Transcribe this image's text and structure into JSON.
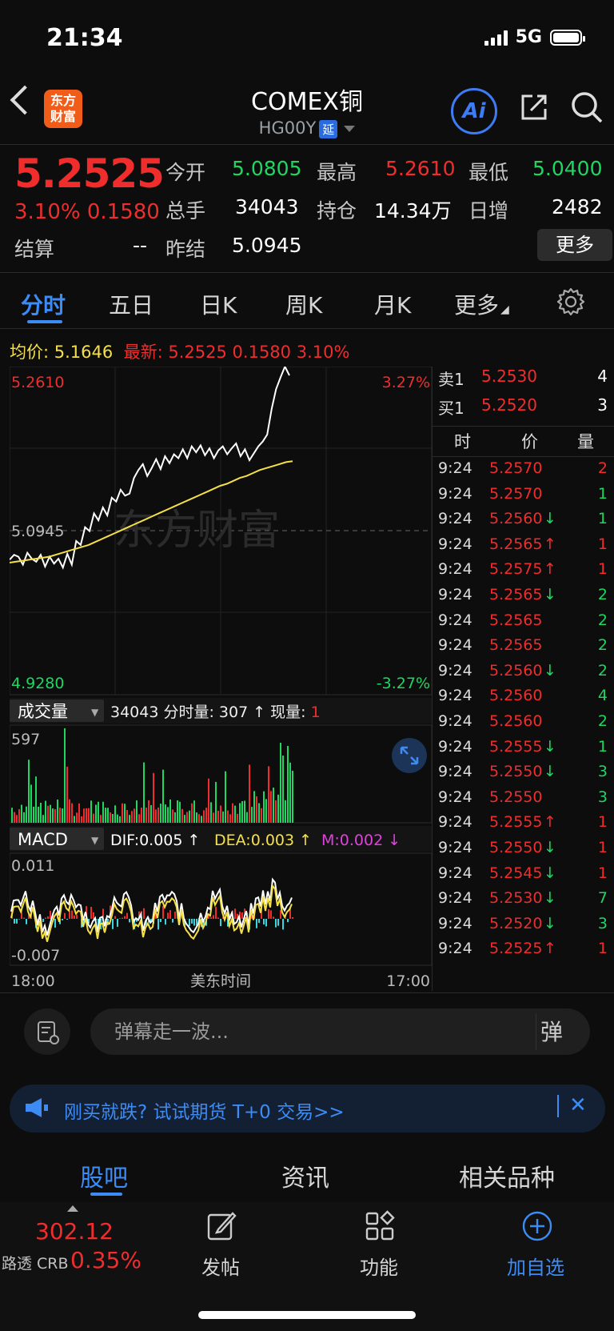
{
  "status_bar": {
    "time": "21:34",
    "network": "5G"
  },
  "header": {
    "logo_text_line1": "东方",
    "logo_text_line2": "财富",
    "title": "COMEX铜",
    "code": "HG00Y",
    "delay_tag": "延",
    "ai_label": "Ai"
  },
  "quote": {
    "price": "5.2525",
    "change_pct": "3.10%",
    "change": "0.1580",
    "fields": {
      "open_label": "今开",
      "open": "5.0805",
      "high_label": "最高",
      "high": "5.2610",
      "low_label": "最低",
      "low": "5.0400",
      "volume_label": "总手",
      "volume": "34043",
      "oi_label": "持仓",
      "oi": "14.34万",
      "daily_inc_label": "日增",
      "daily_inc": "2482",
      "settle_label": "结算",
      "settle": "--",
      "prev_settle_label": "昨结",
      "prev_settle": "5.0945"
    },
    "more_button": "更多"
  },
  "chart_tabs": [
    "分时",
    "五日",
    "日K",
    "周K",
    "月K",
    "更多"
  ],
  "info_line": {
    "avg_label": "均价:",
    "avg": "5.1646",
    "last_label": "最新:",
    "last": "5.2525",
    "change": "0.1580",
    "pct": "3.10%"
  },
  "chart_labels": {
    "top_price": "5.2610",
    "top_pct": "3.27%",
    "mid_price": "5.0945",
    "bottom_price": "4.9280",
    "bottom_pct": "-3.27%",
    "watermark": "东方财富",
    "vol_indicator": "成交量",
    "vol_text": "34043 分时量: 307 ↑ 现量: ",
    "vol_current": "1",
    "vol_max": "597",
    "macd_indicator": "MACD",
    "dif": "DIF:0.005 ↑",
    "dea": "DEA:0.003 ↑",
    "m": "M:0.002 ↓",
    "macd_top": "0.011",
    "macd_bottom": "-0.007",
    "time_start": "18:00",
    "time_mid": "美东时间",
    "time_end": "17:00"
  },
  "order_book": {
    "ask_label": "卖1",
    "ask_price": "5.2530",
    "ask_vol": "4",
    "bid_label": "买1",
    "bid_price": "5.2520",
    "bid_vol": "3"
  },
  "trades_header": {
    "time": "时",
    "price": "价",
    "vol": "量"
  },
  "trades": [
    {
      "time": "9:24",
      "price": "5.2570",
      "arrow": "",
      "vol": "2",
      "dir": "up"
    },
    {
      "time": "9:24",
      "price": "5.2570",
      "arrow": "",
      "vol": "1",
      "dir": "down"
    },
    {
      "time": "9:24",
      "price": "5.2560",
      "arrow": "↓",
      "vol": "1",
      "dir": "down"
    },
    {
      "time": "9:24",
      "price": "5.2565",
      "arrow": "↑",
      "vol": "1",
      "dir": "up"
    },
    {
      "time": "9:24",
      "price": "5.2575",
      "arrow": "↑",
      "vol": "1",
      "dir": "up"
    },
    {
      "time": "9:24",
      "price": "5.2565",
      "arrow": "↓",
      "vol": "2",
      "dir": "down"
    },
    {
      "time": "9:24",
      "price": "5.2565",
      "arrow": "",
      "vol": "2",
      "dir": "down"
    },
    {
      "time": "9:24",
      "price": "5.2565",
      "arrow": "",
      "vol": "2",
      "dir": "down"
    },
    {
      "time": "9:24",
      "price": "5.2560",
      "arrow": "↓",
      "vol": "2",
      "dir": "down"
    },
    {
      "time": "9:24",
      "price": "5.2560",
      "arrow": "",
      "vol": "4",
      "dir": "down"
    },
    {
      "time": "9:24",
      "price": "5.2560",
      "arrow": "",
      "vol": "2",
      "dir": "down"
    },
    {
      "time": "9:24",
      "price": "5.2555",
      "arrow": "↓",
      "vol": "1",
      "dir": "down"
    },
    {
      "time": "9:24",
      "price": "5.2550",
      "arrow": "↓",
      "vol": "3",
      "dir": "down"
    },
    {
      "time": "9:24",
      "price": "5.2550",
      "arrow": "",
      "vol": "3",
      "dir": "down"
    },
    {
      "time": "9:24",
      "price": "5.2555",
      "arrow": "↑",
      "vol": "1",
      "dir": "up"
    },
    {
      "time": "9:24",
      "price": "5.2550",
      "arrow": "↓",
      "vol": "1",
      "dir": "up"
    },
    {
      "time": "9:24",
      "price": "5.2545",
      "arrow": "↓",
      "vol": "1",
      "dir": "up"
    },
    {
      "time": "9:24",
      "price": "5.2530",
      "arrow": "↓",
      "vol": "7",
      "dir": "down"
    },
    {
      "time": "9:24",
      "price": "5.2520",
      "arrow": "↓",
      "vol": "3",
      "dir": "down"
    },
    {
      "time": "9:24",
      "price": "5.2525",
      "arrow": "↑",
      "vol": "1",
      "dir": "up"
    }
  ],
  "danmaku": {
    "placeholder": "弹幕走一波...",
    "send_label": "弹"
  },
  "promo": {
    "text": "刚买就跌? 试试期货 T+0 交易>>"
  },
  "community_tabs": [
    "股吧",
    "资讯",
    "相关品种"
  ],
  "bottom_nav": {
    "crb_value": "302.12",
    "crb_name": "路透 CRB",
    "crb_pct": "0.35%",
    "post_label": "发帖",
    "func_label": "功能",
    "add_label": "加自选"
  },
  "colors": {
    "up": "#f02d2d",
    "down": "#1ed760",
    "accent": "#3d8bf5",
    "avg_line": "#f5e047"
  },
  "chart_data": {
    "type": "line",
    "x_range": [
      "18:00",
      "17:00"
    ],
    "ylim": [
      4.928,
      5.261
    ],
    "reference": 5.0945,
    "series": [
      {
        "values": [
          5.065,
          5.07,
          5.068,
          5.06,
          5.072,
          5.066,
          5.063,
          5.07,
          5.058,
          5.068,
          5.061,
          5.066,
          5.057,
          5.071,
          5.06,
          5.084,
          5.08,
          5.098,
          5.094,
          5.112,
          5.105,
          5.118,
          5.11,
          5.128,
          5.124,
          5.136,
          5.13,
          5.132,
          5.148,
          5.156,
          5.162,
          5.15,
          5.158,
          5.167,
          5.157,
          5.17,
          5.163,
          5.172,
          5.168,
          5.177,
          5.168,
          5.18,
          5.174,
          5.181,
          5.171,
          5.178,
          5.168,
          5.176,
          5.18,
          5.172,
          5.178,
          5.183,
          5.17,
          5.177,
          5.166,
          5.173,
          5.18,
          5.185,
          5.192,
          5.218,
          5.238,
          5.25,
          5.261,
          5.252
        ]
      },
      {
        "values": [
          5.062,
          5.063,
          5.064,
          5.065,
          5.066,
          5.067,
          5.068,
          5.07,
          5.072,
          5.074,
          5.076,
          5.078,
          5.08,
          5.083,
          5.086,
          5.089,
          5.092,
          5.095,
          5.098,
          5.101,
          5.104,
          5.107,
          5.11,
          5.113,
          5.116,
          5.119,
          5.122,
          5.125,
          5.128,
          5.131,
          5.134,
          5.137,
          5.14,
          5.142,
          5.145,
          5.148,
          5.15,
          5.153,
          5.156,
          5.158,
          5.16,
          5.162,
          5.164,
          5.165
        ]
      }
    ],
    "volume_max": 597,
    "macd_range": [
      -0.007,
      0.011
    ]
  }
}
